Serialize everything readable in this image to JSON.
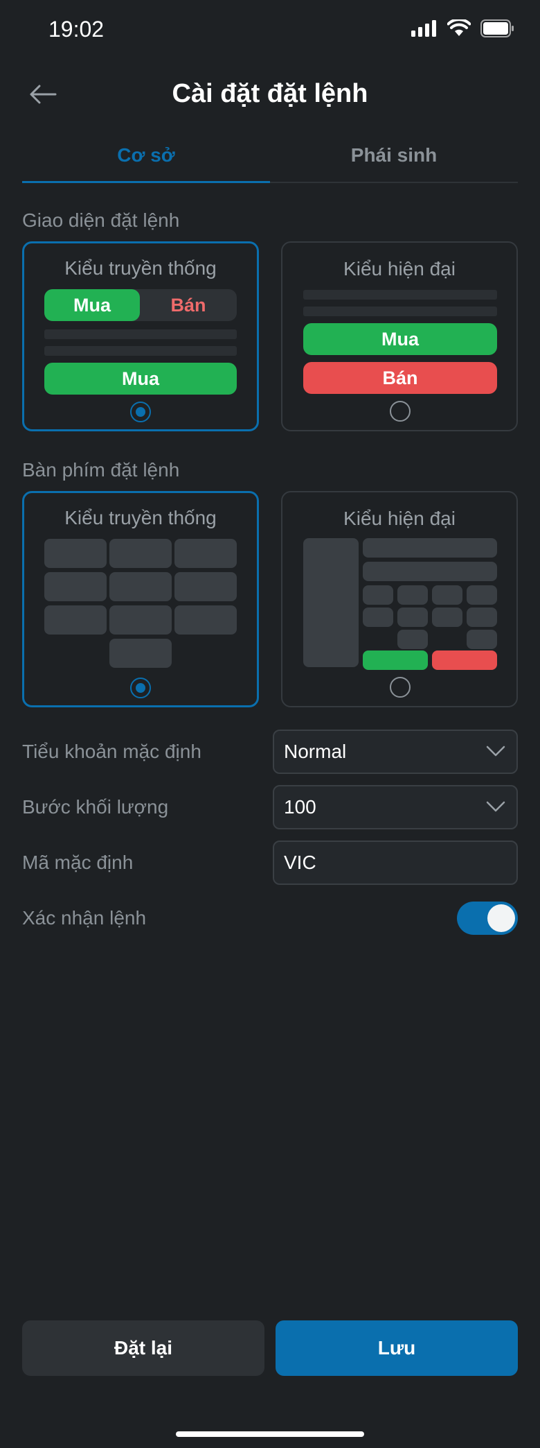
{
  "status_bar": {
    "time": "19:02"
  },
  "header": {
    "title": "Cài đặt đặt lệnh"
  },
  "tabs": [
    {
      "label": "Cơ sở",
      "active": true
    },
    {
      "label": "Phái sinh",
      "active": false
    }
  ],
  "order_ui": {
    "section_label": "Giao diện đặt lệnh",
    "traditional": {
      "title": "Kiểu truyền thống",
      "buy": "Mua",
      "sell": "Bán",
      "action": "Mua",
      "selected": true
    },
    "modern": {
      "title": "Kiểu hiện đại",
      "buy": "Mua",
      "sell": "Bán",
      "selected": false
    }
  },
  "keyboard": {
    "section_label": "Bàn phím đặt lệnh",
    "traditional": {
      "title": "Kiểu truyền thống",
      "selected": true
    },
    "modern": {
      "title": "Kiểu hiện đại",
      "selected": false
    }
  },
  "form": {
    "sub_account": {
      "label": "Tiểu khoản mặc định",
      "value": "Normal"
    },
    "volume_step": {
      "label": "Bước khối lượng",
      "value": "100"
    },
    "default_code": {
      "label": "Mã mặc định",
      "value": "VIC"
    },
    "confirm_order": {
      "label": "Xác nhận lệnh",
      "enabled": true
    }
  },
  "actions": {
    "reset": "Đặt lại",
    "save": "Lưu"
  },
  "colors": {
    "accent": "#0a6fae",
    "buy": "#22b153",
    "sell": "#e84e4f",
    "background": "#1e2124"
  }
}
